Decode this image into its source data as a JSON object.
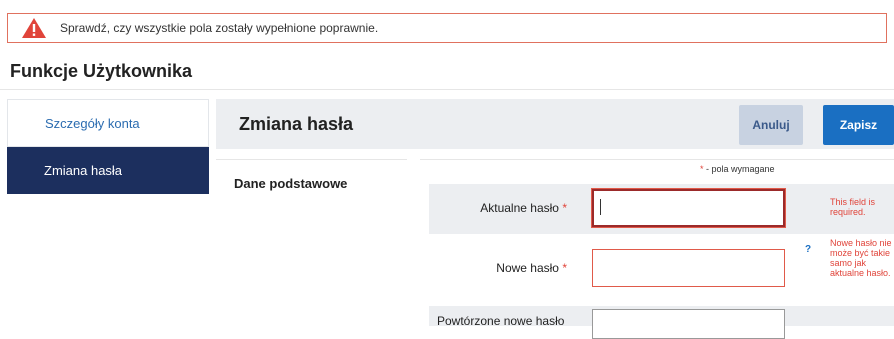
{
  "alert": {
    "message": "Sprawdź, czy wszystkie pola zostały wypełnione poprawnie.",
    "icon": "warning-icon",
    "color": "#e0443a"
  },
  "page": {
    "title": "Funkcje Użytkownika"
  },
  "sidebar": {
    "items": [
      {
        "label": "Szczegóły konta",
        "active": false
      },
      {
        "label": "Zmiana hasła",
        "active": true
      }
    ]
  },
  "header": {
    "title": "Zmiana hasła",
    "cancel_label": "Anuluj",
    "save_label": "Zapisz"
  },
  "form": {
    "section_label": "Dane podstawowe",
    "required_note_star": "*",
    "required_note": " - pola wymagane",
    "fields": [
      {
        "label": "Aktualne hasło",
        "required": "*",
        "value": "",
        "error": "This field is required."
      },
      {
        "label": "Nowe hasło",
        "required": "*",
        "value": "",
        "error": "Nowe hasło nie może być takie samo jak aktualne hasło.",
        "help": "?"
      },
      {
        "label": "Powtórzone nowe hasło",
        "value": ""
      }
    ]
  },
  "colors": {
    "accent": "#1a6fc2",
    "sidebar_active": "#1c2f5e",
    "error": "#e0443a"
  }
}
